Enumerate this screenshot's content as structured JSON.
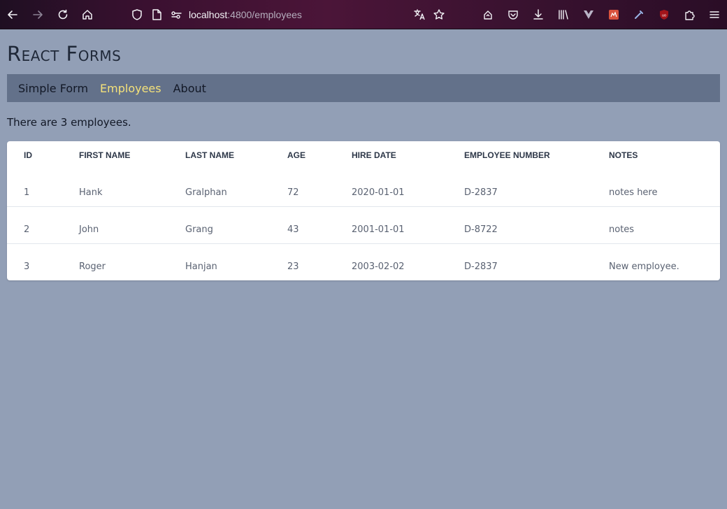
{
  "browser": {
    "url_host": "localhost",
    "url_path": ":4800/employees"
  },
  "page": {
    "title": "React Forms",
    "nav": [
      {
        "label": "Simple Form",
        "active": false
      },
      {
        "label": "Employees",
        "active": true
      },
      {
        "label": "About",
        "active": false
      }
    ],
    "summary": "There are 3 employees."
  },
  "table": {
    "headers": [
      "ID",
      "FIRST NAME",
      "LAST NAME",
      "AGE",
      "HIRE DATE",
      "EMPLOYEE NUMBER",
      "NOTES"
    ],
    "rows": [
      [
        "1",
        "Hank",
        "Gralphan",
        "72",
        "2020-01-01",
        "D-2837",
        "notes here"
      ],
      [
        "2",
        "John",
        "Grang",
        "43",
        "2001-01-01",
        "D-8722",
        "notes"
      ],
      [
        "3",
        "Roger",
        "Hanjan",
        "23",
        "2003-02-02",
        "D-2837",
        "New employee."
      ]
    ]
  },
  "colors": {
    "page_bg": "#929fb6",
    "nav_bg": "#63718a",
    "nav_active": "#f5e27a"
  }
}
